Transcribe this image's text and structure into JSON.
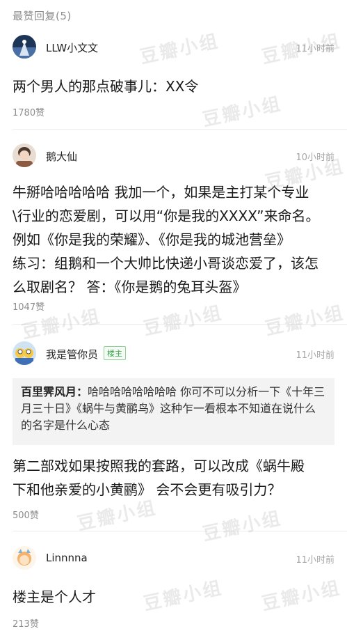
{
  "section": {
    "label": "最赞回复(5)"
  },
  "comments": [
    {
      "username": "LLW小文文",
      "time": "11小时前",
      "text": "两个男人的那点破事儿：XX令",
      "likes": "1780赞"
    },
    {
      "username": "鹅大仙",
      "time": "10小时前",
      "text": "牛掰哈哈哈哈哈 我加一个，如果是主打某个专业\n\\行业的恋爱剧，可以用“你是我的XXXX”来命名。\n例如《你是我的荣耀》、《你是我的城池营垒》\n练习：组鹅和一个大帅比快递小哥谈恋爱了，该怎\n么取剧名？ 答：《你是鹅的兔耳头盔》",
      "likes": "1047赞"
    },
    {
      "username": "我是管你员",
      "badge": "楼主",
      "time": "11小时前",
      "quote_author": "百里霁风月：",
      "quote_text": "哈哈哈哈哈哈哈哈 你可不可以分析一下《十年三月三十日》《蜗牛与黄鹂鸟》这种乍一看根本不知道在说什么的名字是什么心态",
      "text": "第二部戏如果按照我的套路，可以改成《蜗牛殿\n下和他亲爱的小黄鹂》 会不会更有吸引力？",
      "likes": "500赞"
    },
    {
      "username": "Linnnna",
      "time": "11小时前",
      "text": "楼主是个人才",
      "likes": "213赞"
    }
  ],
  "watermark": "豆瓣小组"
}
